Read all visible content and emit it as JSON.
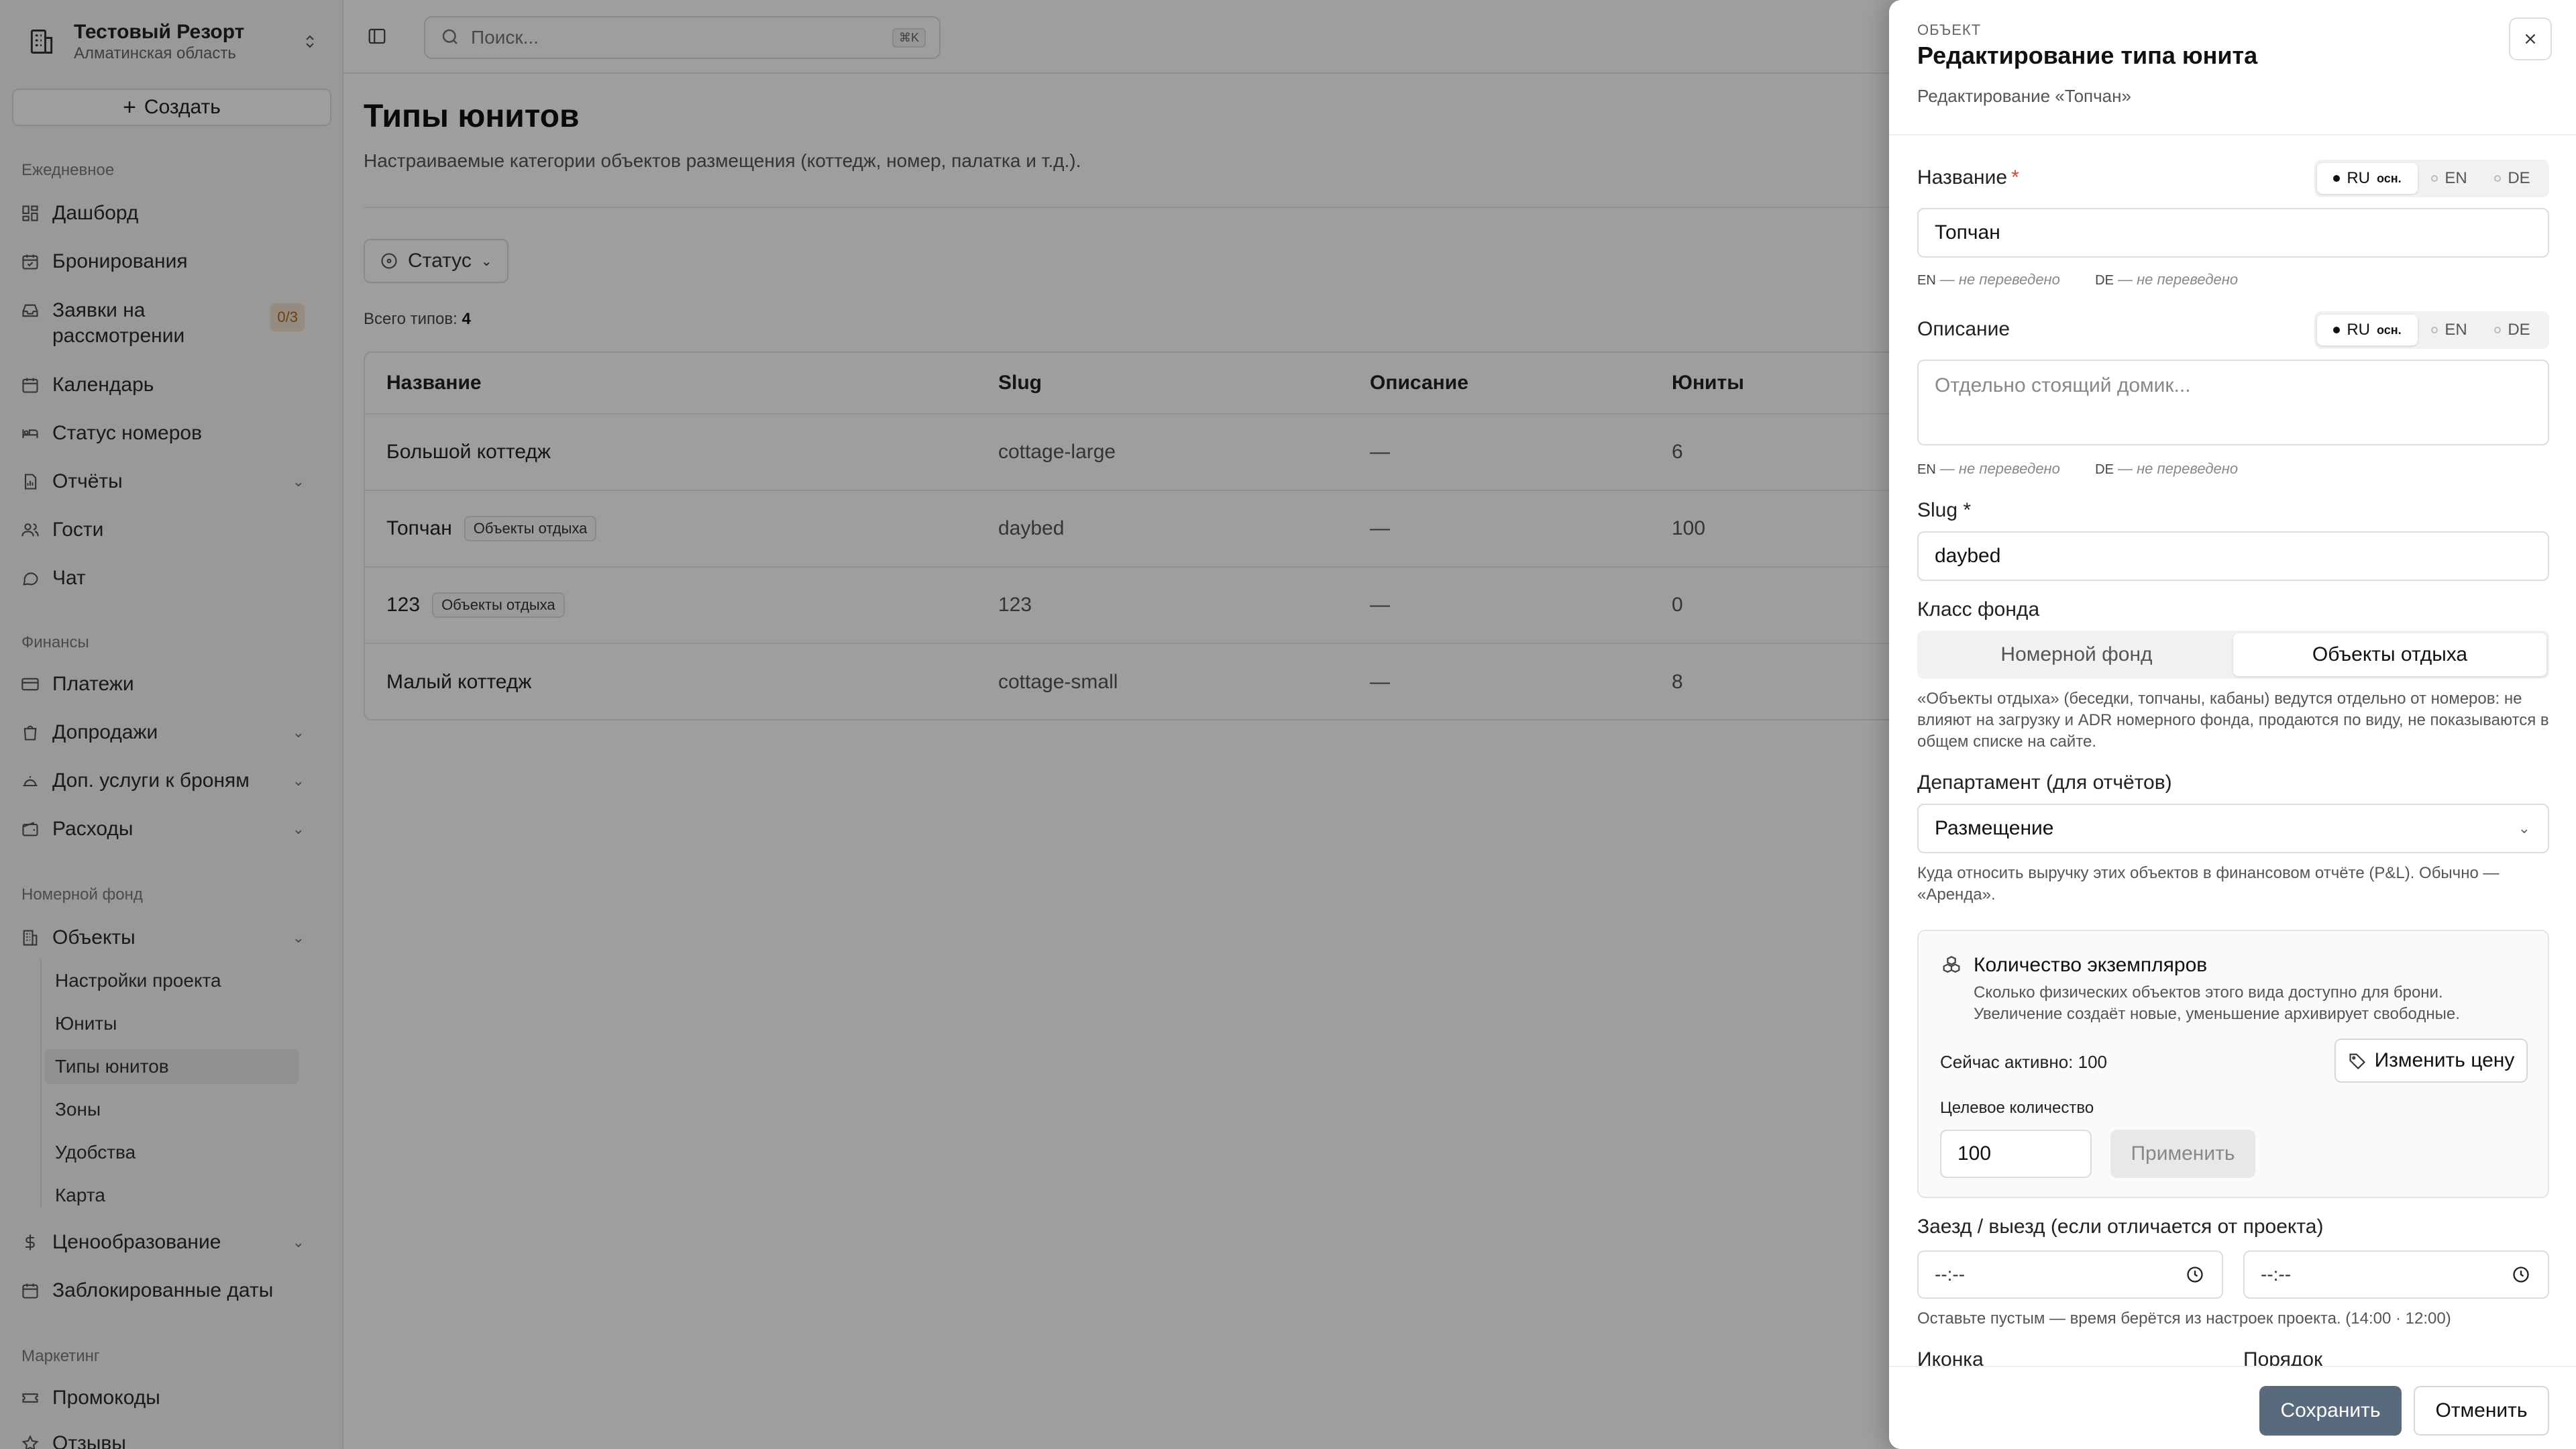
{
  "sidebar": {
    "brand_title": "Тестовый Резорт",
    "brand_subtitle": "Алматинская область",
    "create_label": "Создать",
    "sections": {
      "daily": "Ежедневное",
      "finance": "Финансы",
      "room_stock": "Номерной фонд",
      "marketing": "Маркетинг"
    },
    "items": {
      "dashboard": "Дашборд",
      "bookings": "Бронирования",
      "requests": "Заявки на рассмотрении",
      "requests_badge": "0/3",
      "calendar": "Календарь",
      "room_status": "Статус номеров",
      "reports": "Отчёты",
      "guests": "Гости",
      "chat": "Чат",
      "payments": "Платежи",
      "upsales": "Допродажи",
      "extra_services": "Доп. услуги к броням",
      "expenses": "Расходы",
      "objects": "Объекты",
      "pricing": "Ценообразование",
      "blocked_dates": "Заблокированные даты",
      "promo": "Промокоды",
      "reviews": "Отзывы"
    },
    "subitems": {
      "project_settings": "Настройки проекта",
      "units": "Юниты",
      "unit_types": "Типы юнитов",
      "zones": "Зоны",
      "amenities": "Удобства",
      "map": "Карта"
    }
  },
  "topbar": {
    "search_placeholder": "Поиск...",
    "shortcut": "⌘K"
  },
  "main": {
    "title": "Типы юнитов",
    "subtitle": "Настраиваемые категории объектов размещения (коттедж, номер, палатка и т.д.).",
    "filter_label": "Статус",
    "total_label": "Всего типов:",
    "total_count": "4",
    "table": {
      "headers": {
        "name": "Название",
        "slug": "Slug",
        "description": "Описание",
        "units": "Юниты"
      },
      "rows": [
        {
          "name": "Большой коттедж",
          "tag": "",
          "slug": "cottage-large",
          "description": "—",
          "units": "6"
        },
        {
          "name": "Топчан",
          "tag": "Объекты отдыха",
          "slug": "daybed",
          "description": "—",
          "units": "100"
        },
        {
          "name": "123",
          "tag": "Объекты отдыха",
          "slug": "123",
          "description": "—",
          "units": "0"
        },
        {
          "name": "Малый коттедж",
          "tag": "",
          "slug": "cottage-small",
          "description": "—",
          "units": "8"
        }
      ]
    }
  },
  "drawer": {
    "eyebrow": "ОБЪЕКТ",
    "title": "Редактирование типа юнита",
    "subtitle": "Редактирование «Топчан»",
    "lang": {
      "ru": "RU",
      "ru_main": "осн.",
      "en": "EN",
      "de": "DE"
    },
    "name_label": "Название",
    "required_mark": "*",
    "name_value": "Топчан",
    "tr_en_code": "EN",
    "tr_de_code": "DE",
    "tr_missing": "— не переведено",
    "description_label": "Описание",
    "description_placeholder": "Отдельно стоящий домик...",
    "slug_label": "Slug *",
    "slug_value": "daybed",
    "stock_class_label": "Класс фонда",
    "stock_class_options": {
      "rooms": "Номерной фонд",
      "leisure": "Объекты отдыха"
    },
    "stock_class_help": "«Объекты отдыха» (беседки, топчаны, кабаны) ведутся отдельно от номеров: не влияют на загрузку и ADR номерного фонда, продаются по виду, не показываются в общем списке на сайте.",
    "department_label": "Департамент (для отчётов)",
    "department_value": "Размещение",
    "department_help": "Куда относить выручку этих объектов в финансовом отчёте (P&L). Обычно — «Аренда».",
    "instances": {
      "title": "Количество экземпляров",
      "desc": "Сколько физических объектов этого вида доступно для брони. Увеличение создаёт новые, уменьшение архивирует свободные.",
      "active_label": "Сейчас активно: 100",
      "change_price": "Изменить цену",
      "target_label": "Целевое количество",
      "target_value": "100",
      "apply": "Применить"
    },
    "checkin_label": "Заезд / выезд (если отличается от проекта)",
    "time_placeholder": "--:--",
    "checkin_help": "Оставьте пустым — время берётся из настроек проекта.  (14:00 · 12:00)",
    "icon_label": "Иконка",
    "order_label": "Порядок",
    "save": "Сохранить",
    "cancel": "Отменить"
  }
}
